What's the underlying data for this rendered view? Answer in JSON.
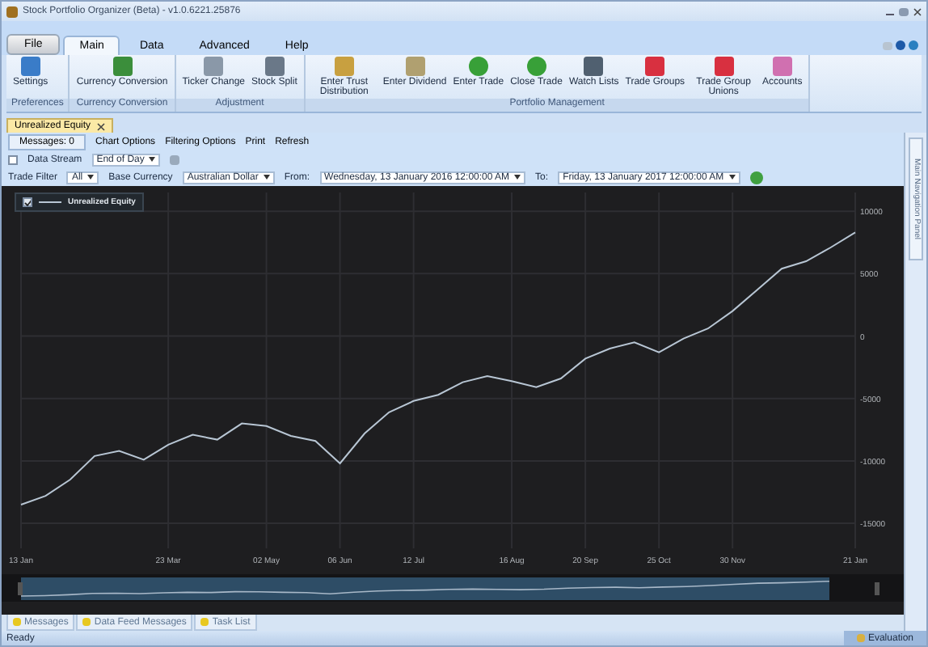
{
  "window": {
    "title": "Stock Portfolio Organizer (Beta) - v1.0.6221.25876"
  },
  "ribbon": {
    "file_tab": "File",
    "tabs": [
      {
        "label": "Main",
        "selected": true
      },
      {
        "label": "Data",
        "selected": false
      },
      {
        "label": "Advanced",
        "selected": false
      },
      {
        "label": "Help",
        "selected": false
      }
    ],
    "groups": [
      {
        "label": "Preferences",
        "buttons": [
          "Settings"
        ]
      },
      {
        "label": "Currency Conversion",
        "buttons": [
          "Currency Conversion"
        ]
      },
      {
        "label": "Adjustment",
        "buttons": [
          "Ticker Change",
          "Stock Split"
        ]
      },
      {
        "label": "Portfolio Management",
        "buttons": [
          "Enter Trust Distribution",
          "Enter Dividend",
          "Enter Trade",
          "Close Trade",
          "Watch Lists",
          "Trade Groups",
          "Trade Group Unions",
          "Accounts"
        ]
      }
    ]
  },
  "document_tabs": [
    {
      "label": "Unrealized Equity",
      "selected": true
    }
  ],
  "toolbar": {
    "messages_button": "Messages: 0",
    "menu_items": [
      "Chart Options",
      "Filtering Options",
      "Print",
      "Refresh"
    ]
  },
  "data_stream": {
    "checked": false,
    "label": "Data Stream",
    "value": "End of Day"
  },
  "filters": [
    {
      "label": "Trade Filter",
      "value": "All"
    },
    {
      "label": "Base Currency",
      "value": "Australian Dollar"
    },
    {
      "label": "From:",
      "value": "Wednesday, 13 January 2016 12:00:00 AM"
    },
    {
      "label": "To:",
      "value": "Friday, 13 January 2017 12:00:00 AM"
    }
  ],
  "chart": {
    "legend": {
      "checked": true,
      "label": "Unrealized Equity"
    },
    "chart_data": {
      "type": "line",
      "categories": [
        "13 Jan",
        null,
        null,
        null,
        null,
        null,
        "23 Mar",
        null,
        null,
        null,
        "02 May",
        null,
        null,
        "06 Jun",
        null,
        null,
        "12 Jul",
        null,
        null,
        null,
        "16 Aug",
        null,
        null,
        "20 Sep",
        null,
        null,
        "25 Oct",
        null,
        null,
        "30 Nov",
        null,
        null,
        null,
        null,
        "21 Jan"
      ],
      "ylim": [
        -17000,
        11500
      ],
      "grid": true,
      "yticks": [
        10000,
        5000,
        0,
        -5000,
        -10000,
        -15000
      ],
      "series": [
        {
          "color": "#b8c6d4",
          "values": [
            -13500,
            -12800,
            -11500,
            -9600,
            -9200,
            -9900,
            -8700,
            -7900,
            -8300,
            -7000,
            -7200,
            -8000,
            -8400,
            -10200,
            -7800,
            -6100,
            -5200,
            -4700,
            -3700,
            -3200,
            -3600,
            -4100,
            -3400,
            -1800,
            -1000,
            -500,
            -1300,
            -200,
            600,
            2000,
            3700,
            5400,
            6000,
            7100,
            8300
          ]
        }
      ]
    }
  },
  "side_panel": {
    "label": "Main Navigation Panel"
  },
  "bottom_tabs": [
    "Messages",
    "Data Feed Messages",
    "Task List"
  ],
  "status_bar": {
    "text": "Ready",
    "license": "Evaluation"
  }
}
